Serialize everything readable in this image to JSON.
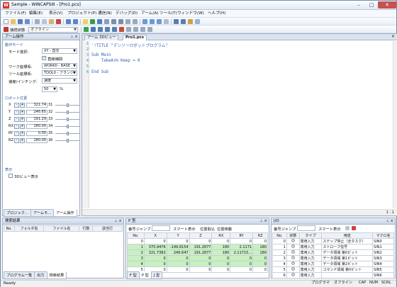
{
  "window": {
    "title": "Sample - WINCAPSIII - [Pro1.pcs]",
    "app_icon": "W"
  },
  "menu": [
    "ファイル(F)",
    "編集(E)",
    "表示(V)",
    "プロジェクト(P)",
    "通信(N)",
    "デバッグ(D)",
    "アーム(A)",
    "ツール(T)",
    "ウィンドウ(W)",
    "ヘルプ(H)"
  ],
  "toolbar2": {
    "connection_label": "接続状態",
    "connection_value": "オフライン"
  },
  "arm_panel": {
    "title": "アーム操作",
    "motion_mode_header": "動作モード",
    "mode_label": "モード選択:",
    "mode_value": "XY - 直交",
    "interp_label": "直線補間",
    "work_label": "ワーク座標系:",
    "work_value": "WORK0 - BASE",
    "tool_label": "ツール座標系:",
    "tool_value": "TOOL0 - フランジ",
    "speed_label": "速度/インチング:",
    "speed_mode": "速度",
    "speed_value": "50",
    "speed_unit": "%",
    "robot_pos_header": "ロボット位置",
    "positions": [
      {
        "axis": "X",
        "value": "321.74",
        "idx": "31"
      },
      {
        "axis": "Y",
        "value": "246.65",
        "idx": "32"
      },
      {
        "axis": "Z",
        "value": "191.29",
        "idx": "33"
      },
      {
        "axis": "RX",
        "value": "180.00",
        "idx": "34"
      },
      {
        "axis": "RY",
        "value": "0.00",
        "idx": "35"
      },
      {
        "axis": "RZ",
        "value": "180.00",
        "idx": "36"
      }
    ],
    "display_header": "表示",
    "view3d_label": "3Dビュー表示",
    "tabs": [
      "プロジェク...",
      "アームモ...",
      "アーム操作"
    ]
  },
  "editor": {
    "tabs": [
      "アーム 3Dビュー",
      "Pro1.pcs"
    ],
    "lines": [
      "'!TITLE \"デンソーロボットプログラム\"",
      "",
      "Sub Main",
      "    TakeArm Keep = 0",
      "",
      "End Sub"
    ],
    "cursor_pos": "1 : 1"
  },
  "search_panel": {
    "title": "検索結果",
    "columns": [
      "No.",
      "フォルダ名",
      "ファイル名",
      "行数",
      "該当行"
    ],
    "tabs": [
      "プログラム一覧",
      "出力",
      "検索結果"
    ]
  },
  "p_panel": {
    "title": "P 型",
    "jump_label": "番号ジャンプ",
    "smart_label": "スマート表示",
    "capture_label": "位置取込",
    "move_label": "位置移動",
    "columns": [
      "No.",
      "X",
      "Y",
      "Z",
      "RX",
      "RY",
      "RZ"
    ],
    "rows": [
      [
        "0",
        "0",
        "0",
        "0",
        "0",
        "0",
        "0"
      ],
      [
        "1",
        "375.9476",
        "-199.8154",
        "191.2877",
        "180",
        "2.1171",
        "180"
      ],
      [
        "2",
        "321.7382",
        "246.647",
        "191.2877",
        "180",
        "2.11715...",
        "180"
      ],
      [
        "3",
        "0",
        "0",
        "0",
        "0",
        "0",
        "0"
      ],
      [
        "4",
        "0",
        "0",
        "0",
        "0",
        "0",
        "0"
      ],
      [
        "5",
        "0",
        "0",
        "0",
        "0",
        "0",
        "0"
      ]
    ],
    "tabs": [
      "F 型",
      "P 型",
      "J 型"
    ]
  },
  "io_panel": {
    "title": "I/O",
    "jump_label": "番号ジャンプ",
    "smart_label": "スマート表示",
    "columns": [
      "No.",
      "状態",
      "タイプ",
      "用途",
      "マクロ名"
    ],
    "rows": [
      [
        "0",
        "専用入力",
        "ステップ停止（全タスク）",
        "SIN0"
      ],
      [
        "1",
        "専用入力",
        "ストローブ信号",
        "SIN1"
      ],
      [
        "2",
        "専用入力",
        "データ領域 第0ビット",
        "SIN2"
      ],
      [
        "3",
        "専用入力",
        "データ領域 第1ビット",
        "SIN3"
      ],
      [
        "4",
        "専用入力",
        "データ領域 第2ビット",
        "SIN4"
      ],
      [
        "5",
        "専用入力",
        "コマンド領域 第0ビット",
        "SIN5"
      ],
      [
        "6",
        "専用入力",
        "",
        "SIN6"
      ]
    ]
  },
  "status": {
    "left": "Ready",
    "items": [
      "プログラマ",
      "オフライン",
      "CAP",
      "NUM",
      "SCRL"
    ]
  }
}
